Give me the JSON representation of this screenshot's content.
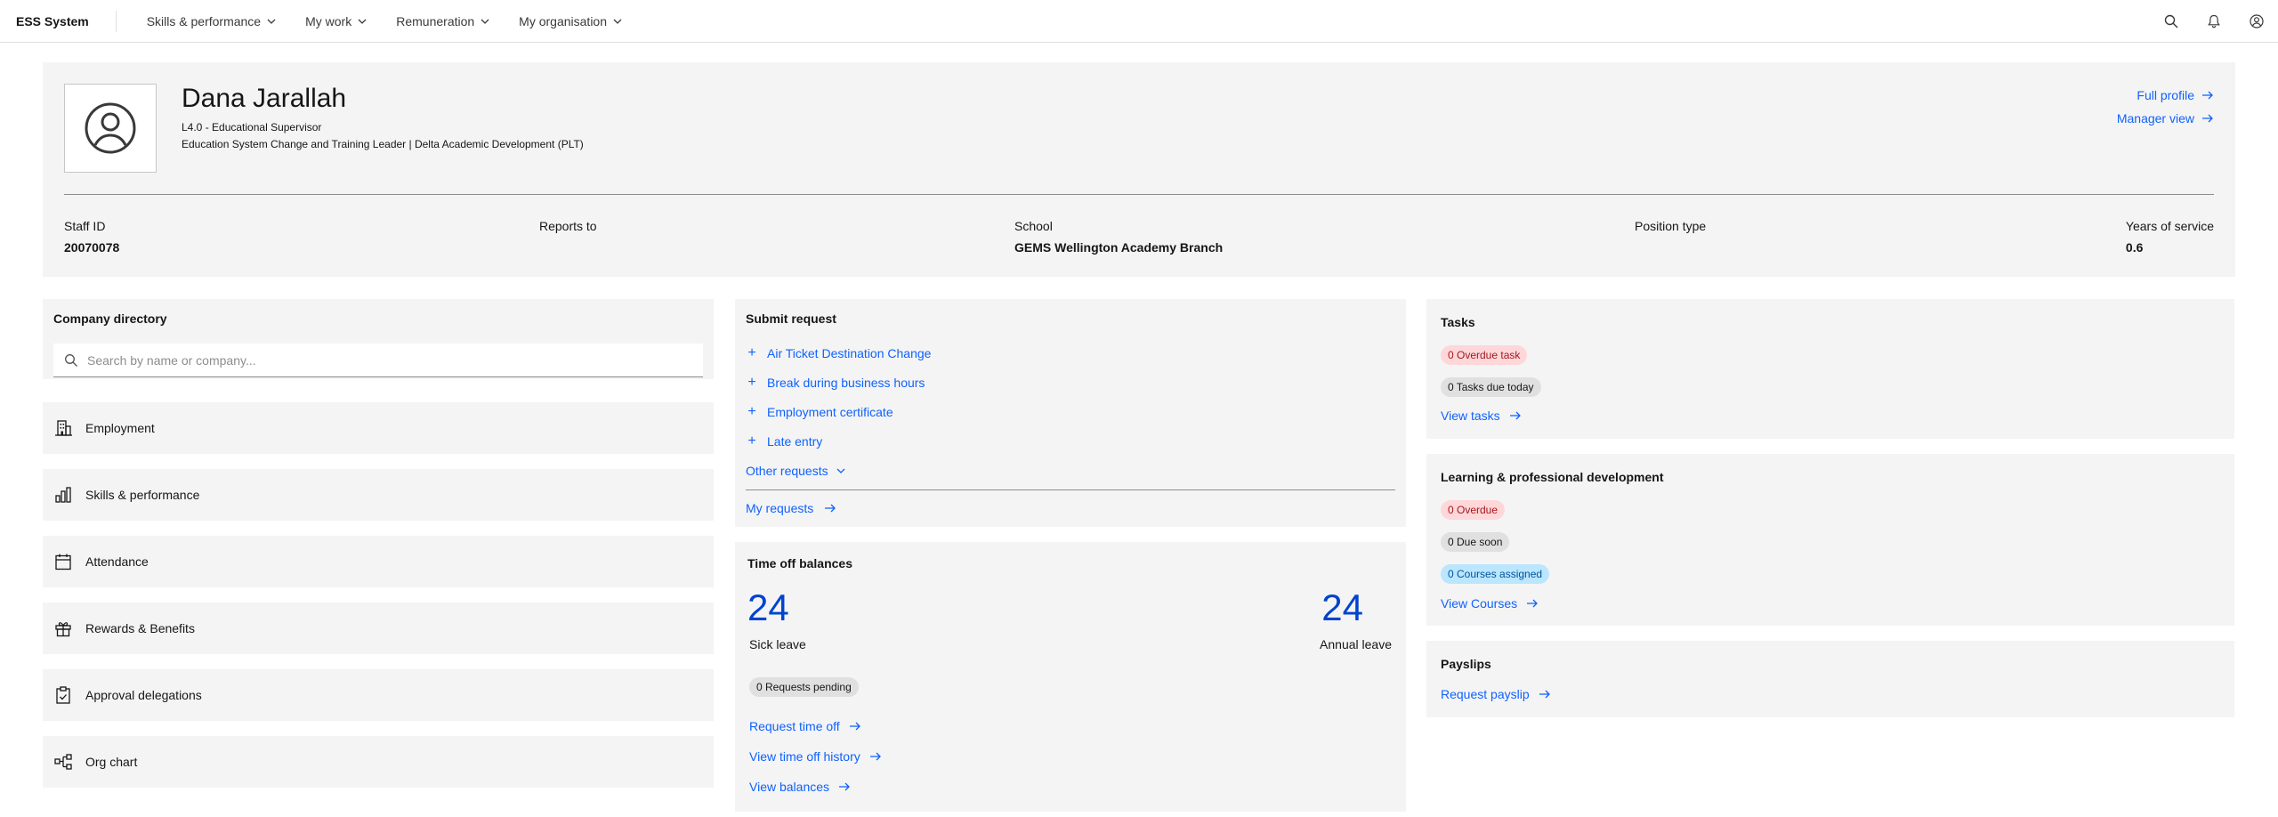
{
  "app": {
    "title": "ESS System"
  },
  "nav": [
    {
      "label": "Skills & performance"
    },
    {
      "label": "My work"
    },
    {
      "label": "Remuneration"
    },
    {
      "label": "My organisation"
    }
  ],
  "top_icons": [
    "search-icon",
    "notification-icon",
    "user-avatar-icon"
  ],
  "profile": {
    "name": "Dana Jarallah",
    "role": "L4.0 - Educational Supervisor",
    "department": "Education System Change and Training Leader | Delta Academic Development (PLT)",
    "full_profile_label": "Full profile",
    "manager_view_label": "Manager view",
    "stats": {
      "staff_id": {
        "label": "Staff ID",
        "value": "20070078"
      },
      "reports_to": {
        "label": "Reports to",
        "value": ""
      },
      "school": {
        "label": "School",
        "value": "GEMS Wellington Academy Branch"
      },
      "position_type": {
        "label": "Position type",
        "value": ""
      },
      "years_of_service": {
        "label": "Years of service",
        "value": "0.6"
      }
    }
  },
  "directory": {
    "title": "Company directory",
    "search_placeholder": "Search by name or company...",
    "items": [
      {
        "label": "Employment",
        "icon": "building-icon"
      },
      {
        "label": "Skills & performance",
        "icon": "bar-chart-icon"
      },
      {
        "label": "Attendance",
        "icon": "calendar-icon"
      },
      {
        "label": "Rewards & Benefits",
        "icon": "gift-icon"
      },
      {
        "label": "Approval delegations",
        "icon": "clipboard-icon"
      },
      {
        "label": "Org chart",
        "icon": "org-chart-icon"
      }
    ]
  },
  "submit_request": {
    "title": "Submit request",
    "items": [
      "Air Ticket Destination Change",
      "Break during business hours",
      "Employment certificate",
      "Late entry"
    ],
    "other_label": "Other requests",
    "my_requests_label": "My requests"
  },
  "time_off": {
    "title": "Time off balances",
    "sick_value": "24",
    "sick_label": "Sick leave",
    "annual_value": "24",
    "annual_label": "Annual leave",
    "pending_tag": "0 Requests pending",
    "links": [
      "Request time off",
      "View time off history",
      "View balances"
    ]
  },
  "tasks": {
    "title": "Tasks",
    "overdue_tag": "0 Overdue task",
    "due_today_tag": "0 Tasks due today",
    "link": "View tasks"
  },
  "learning": {
    "title": "Learning & professional development",
    "overdue_tag": "0 Overdue",
    "due_soon_tag": "0 Due soon",
    "assigned_tag": "0 Courses assigned",
    "link": "View Courses"
  },
  "payslips": {
    "title": "Payslips",
    "link": "Request payslip"
  },
  "colors": {
    "link": "#0f62fe",
    "balance": "#0043ce",
    "card_bg": "#f4f4f4",
    "tag_red_bg": "#ffd7d9",
    "tag_blue_bg": "#bae6ff",
    "tag_grey_bg": "#e0e0e0"
  }
}
